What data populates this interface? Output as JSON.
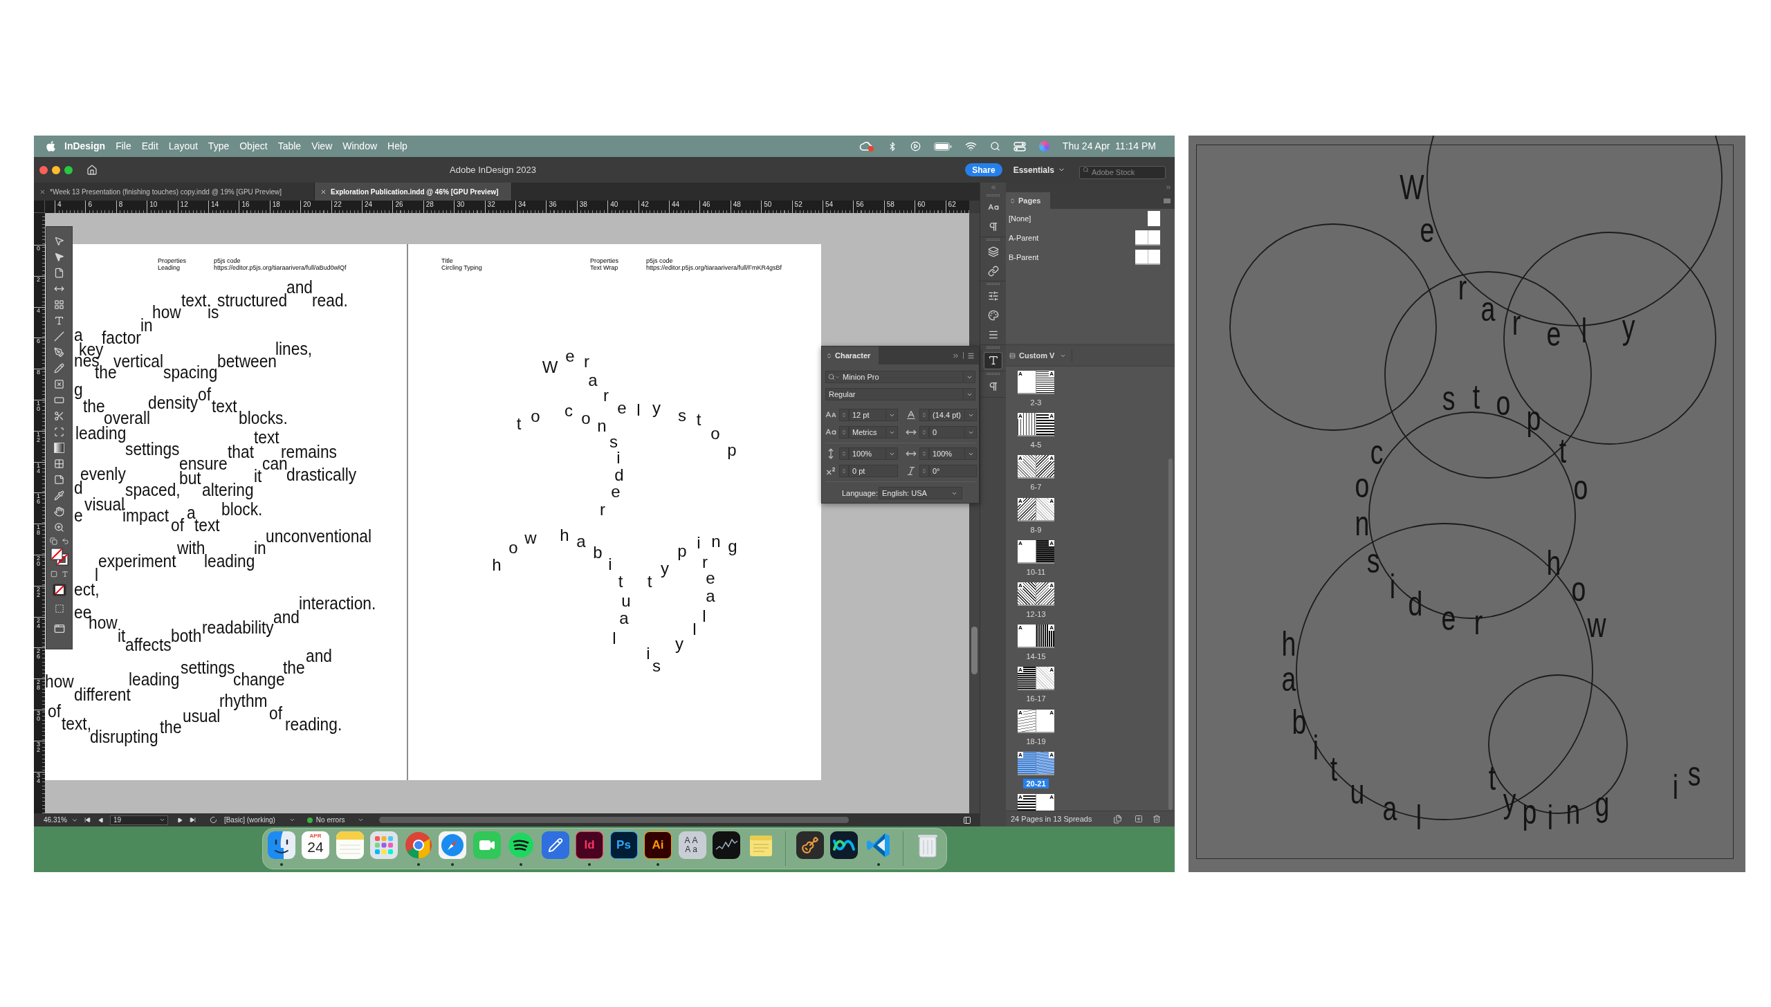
{
  "menu_bar": {
    "app": "InDesign",
    "menus": [
      "File",
      "Edit",
      "Layout",
      "Type",
      "Object",
      "Table",
      "View",
      "Window",
      "Help"
    ],
    "clock": "Thu 24 Apr  11:14 PM"
  },
  "window": {
    "title": "Adobe InDesign 2023",
    "share": "Share",
    "workspace": "Essentials",
    "search": {
      "placeholder": "Adobe Stock"
    }
  },
  "tabs": [
    {
      "label": "*Week 13 Presentation (finishing touches) copy.indd @ 19% [GPU Preview]",
      "selected": false
    },
    {
      "label": "Exploration Publication.indd @ 46% [GPU Preview]",
      "selected": true
    }
  ],
  "rulers": {
    "horizontal": [
      "4",
      "6",
      "8",
      "10",
      "12",
      "14",
      "16",
      "18",
      "20",
      "22",
      "24",
      "26",
      "28",
      "30",
      "32",
      "34",
      "36",
      "38",
      "40",
      "42",
      "44",
      "46",
      "48",
      "50",
      "52",
      "54",
      "56",
      "58",
      "60",
      "62"
    ],
    "vertical": [
      "0",
      "2",
      "4",
      "6",
      "8",
      "10",
      "12",
      "14",
      "16",
      "18",
      "20",
      "22",
      "24",
      "26",
      "28",
      "30",
      "32",
      "34"
    ]
  },
  "left_page": {
    "header": [
      {
        "label": "Properties",
        "value": "Leading"
      },
      {
        "label": "p5js code",
        "value": "https://editor.p5js.org/tiaraarivera/full/aBud0wlQf"
      }
    ],
    "words": [
      "how",
      "text.",
      "is",
      "structured",
      "and",
      "read.",
      "in",
      "a",
      "factor",
      "key",
      "nes",
      "the",
      "vertical",
      "spacing",
      "between",
      "lines,",
      "g",
      "the",
      "overall",
      "density",
      "of",
      "text",
      "blocks.",
      "leading",
      "settings",
      "text",
      "that",
      "remains",
      "ensure",
      "can",
      "d",
      "evenly",
      "but",
      "it",
      "drastically",
      "spaced,",
      "altering",
      "e",
      "visual",
      "impact",
      "of",
      "a",
      "text",
      "block.",
      "unconventional",
      "in",
      "with",
      "experiment",
      "leading",
      "l",
      "ect,",
      "interaction.",
      "ee",
      "how",
      "readability",
      "and",
      "it",
      "both",
      "affects",
      "and",
      "settings",
      "the",
      "how",
      "leading",
      "change",
      "different",
      "rhythm",
      "of",
      "usual",
      "of",
      "text,",
      "the",
      "reading.",
      "disrupting"
    ]
  },
  "right_page": {
    "header": [
      {
        "label": "Title",
        "value": "Circling Typing"
      },
      {
        "label": "Properties",
        "value": "Text Wrap"
      },
      {
        "label": "p5js code",
        "value": "https://editor.p5js.org/tiaraarivera/full/FmKR4gsBf"
      }
    ],
    "letters": [
      "W",
      "e",
      "r",
      "a",
      "r",
      "e",
      "l",
      "y",
      "s",
      "t",
      "o",
      "p",
      "t",
      "o",
      "c",
      "o",
      "n",
      "s",
      "i",
      "d",
      "e",
      "r",
      "h",
      "o",
      "w",
      "h",
      "a",
      "b",
      "i",
      "t",
      "u",
      "a",
      "l",
      "t",
      "y",
      "p",
      "i",
      "n",
      "g",
      "r",
      "e",
      "a",
      "l",
      "l",
      "y",
      "i",
      "s"
    ]
  },
  "character_panel": {
    "title": "Character",
    "font": "Minion Pro",
    "style": "Regular",
    "fields": [
      {
        "kind": "combo",
        "value": "12 pt"
      },
      {
        "kind": "combo",
        "value": "(14.4 pt)"
      },
      {
        "kind": "combo",
        "value": "Metrics"
      },
      {
        "kind": "combo",
        "value": "0"
      },
      {
        "kind": "combo",
        "value": "100%"
      },
      {
        "kind": "combo",
        "value": "100%"
      },
      {
        "kind": "field",
        "value": "0 pt"
      },
      {
        "kind": "field",
        "value": "0°"
      }
    ],
    "language_label": "Language:",
    "language": "English: USA"
  },
  "pages_panel": {
    "title": "Pages",
    "parents": [
      {
        "name": "[None]",
        "kind": "single"
      },
      {
        "name": "A-Parent",
        "kind": "spread"
      },
      {
        "name": "B-Parent",
        "kind": "spread"
      }
    ],
    "view": "Custom V",
    "spreads": [
      {
        "label": "2-3",
        "masters": [
          "A",
          "A"
        ],
        "selected": false
      },
      {
        "label": "4-5",
        "masters": [
          "A",
          "A"
        ],
        "selected": false
      },
      {
        "label": "6-7",
        "masters": [
          "A",
          "A"
        ],
        "selected": false
      },
      {
        "label": "8-9",
        "masters": [
          "A",
          "A"
        ],
        "selected": false
      },
      {
        "label": "10-11",
        "masters": [
          "A",
          "A"
        ],
        "selected": false
      },
      {
        "label": "12-13",
        "masters": [
          "A",
          "A"
        ],
        "selected": false
      },
      {
        "label": "14-15",
        "masters": [
          "A",
          "A"
        ],
        "selected": false
      },
      {
        "label": "16-17",
        "masters": [
          "A",
          "A"
        ],
        "selected": false
      },
      {
        "label": "18-19",
        "masters": [
          "A",
          "A"
        ],
        "selected": false
      },
      {
        "label": "20-21",
        "masters": [
          "A",
          "A"
        ],
        "selected": true
      }
    ],
    "partial_spread": {
      "masters": [
        "A",
        "A"
      ]
    },
    "footer": "24 Pages in 13 Spreads"
  },
  "status_bar": {
    "zoom": "46.31%",
    "page": "19",
    "profile": "[Basic] (working)",
    "preflight": "No errors"
  },
  "dock": [
    {
      "kind": "finder",
      "running": true
    },
    {
      "kind": "calendar",
      "month": "APR",
      "day": "24",
      "running": false
    },
    {
      "kind": "notes",
      "running": false
    },
    {
      "kind": "launchpad",
      "running": false
    },
    {
      "kind": "chrome",
      "running": true
    },
    {
      "kind": "safari",
      "running": true
    },
    {
      "kind": "facetime",
      "running": false
    },
    {
      "kind": "spotify",
      "running": true
    },
    {
      "kind": "pencil",
      "running": false
    },
    {
      "kind": "indesign",
      "label": "Id",
      "running": true
    },
    {
      "kind": "photoshop",
      "label": "Ps",
      "running": false
    },
    {
      "kind": "illustrator",
      "label": "Ai",
      "running": true
    },
    {
      "kind": "fontbook",
      "lines": [
        "AA",
        "Aa"
      ],
      "running": false
    },
    {
      "kind": "stocks",
      "running": false
    },
    {
      "kind": "stickies",
      "running": false
    },
    {
      "kind": "separator"
    },
    {
      "kind": "garageband",
      "running": false
    },
    {
      "kind": "webex",
      "running": false
    },
    {
      "kind": "vscode",
      "running": true
    },
    {
      "kind": "separator"
    },
    {
      "kind": "trash",
      "running": false
    }
  ],
  "artwork": {
    "letters": [
      "W",
      "e",
      "r",
      "a",
      "r",
      "e",
      "l",
      "y",
      "s",
      "t",
      "o",
      "p",
      "t",
      "o",
      "c",
      "o",
      "n",
      "s",
      "i",
      "d",
      "e",
      "r",
      "h",
      "o",
      "w",
      "h",
      "a",
      "b",
      "i",
      "t",
      "u",
      "a",
      "l",
      "t",
      "y",
      "p",
      "i",
      "n",
      "g",
      "i",
      "s"
    ]
  }
}
